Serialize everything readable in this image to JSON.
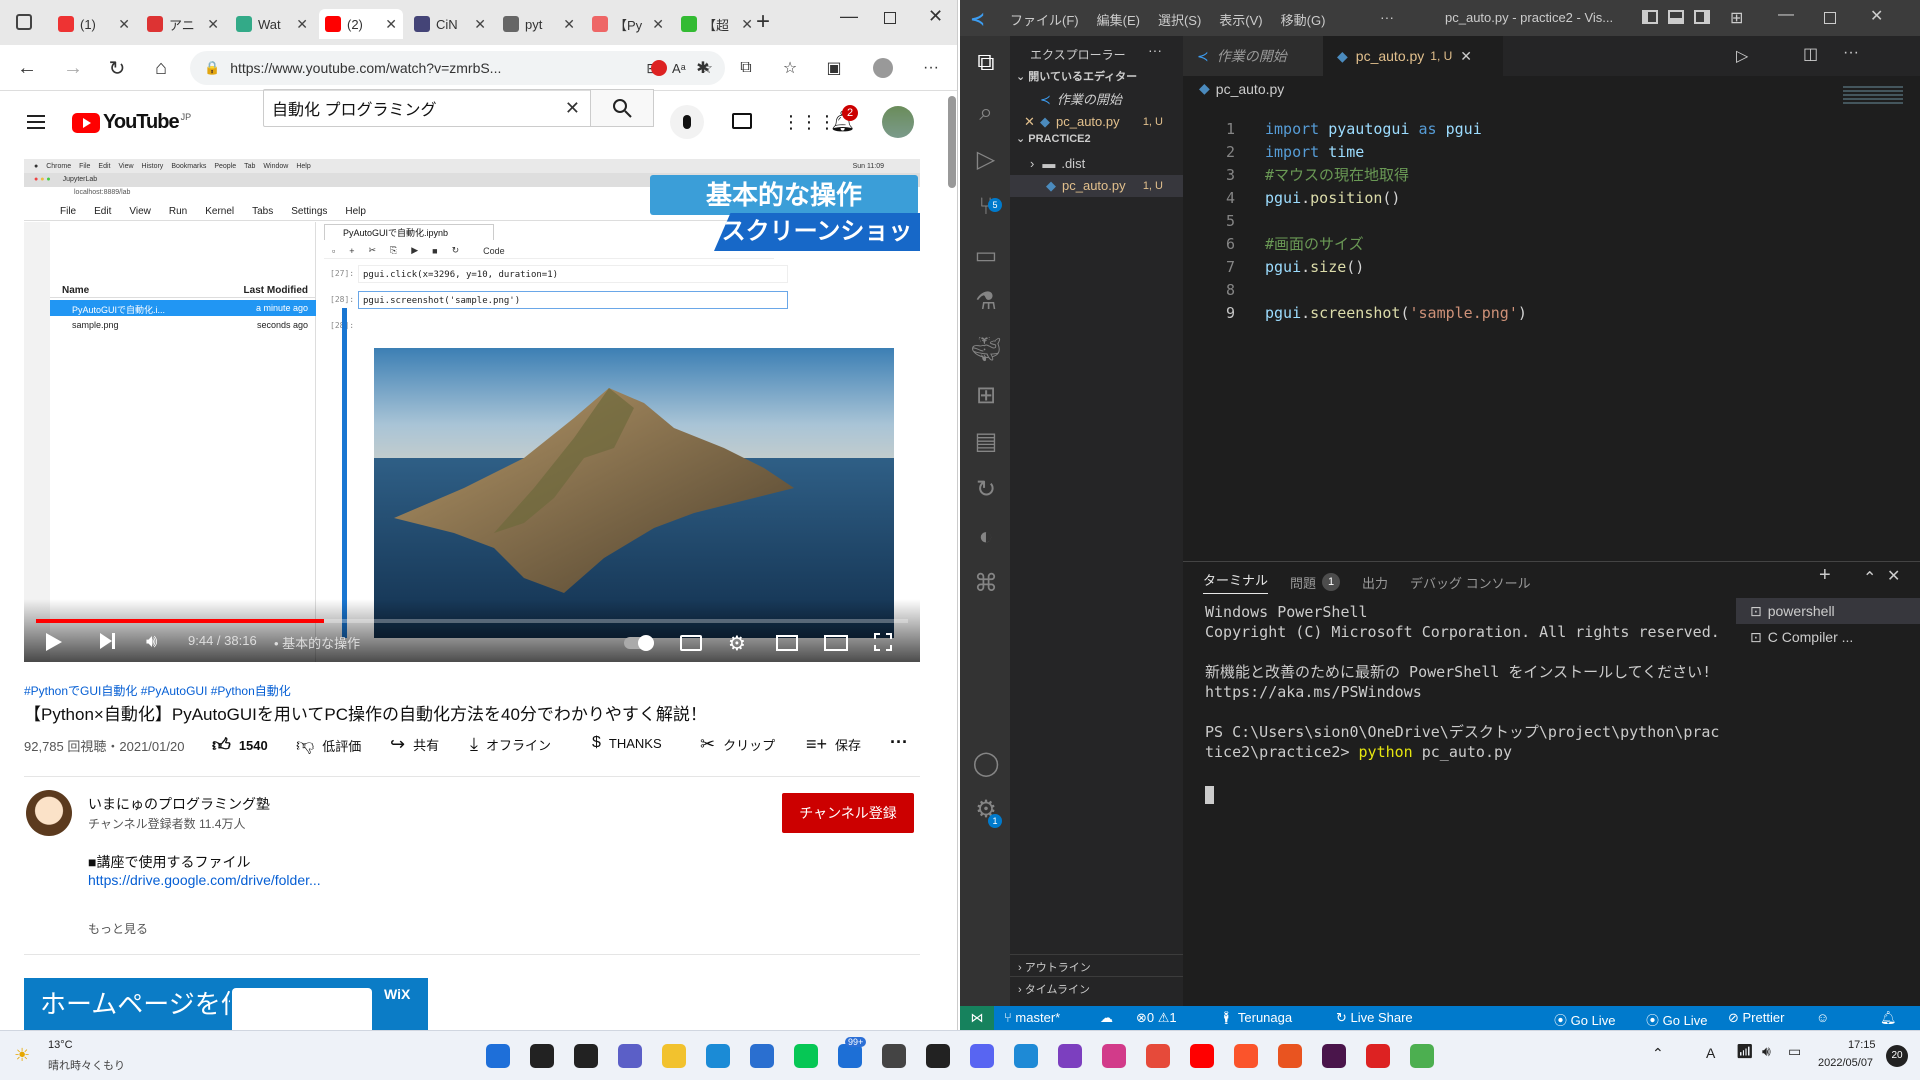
{
  "browser": {
    "tabs": [
      {
        "title": "(1)",
        "color": "#e33"
      },
      {
        "title": "アニ",
        "color": "#d33"
      },
      {
        "title": "Wat",
        "color": "#3a8"
      },
      {
        "title": "(2)",
        "color": "#f00"
      },
      {
        "title": "CiN",
        "color": "#447"
      },
      {
        "title": "pyt",
        "color": "#666"
      },
      {
        "title": "【Py",
        "color": "#e66"
      },
      {
        "title": "【超",
        "color": "#3b3"
      }
    ],
    "url": "https://www.youtube.com/watch?v=zmrbS..."
  },
  "youtube": {
    "logo_text": "YouTube",
    "logo_region": "JP",
    "search_value": "自動化 プログラミング",
    "notif_count": "2",
    "video": {
      "overlay_title1": "基本的な操作",
      "overlay_title2": "スクリーンショット",
      "notebook_tab": "PyAutoGUIで自動化.ipynb",
      "menu": [
        "File",
        "Edit",
        "View",
        "Run",
        "Kernel",
        "Tabs",
        "Settings",
        "Help"
      ],
      "mac_menu": [
        "Chrome",
        "File",
        "Edit",
        "View",
        "History",
        "Bookmarks",
        "People",
        "Tab",
        "Window",
        "Help"
      ],
      "mac_clock": "Sun 11:09",
      "browser_tab": "JupyterLab",
      "browser_url": "localhost:8889/lab",
      "file_col_name": "Name",
      "file_col_mod": "Last Modified",
      "files": [
        {
          "name": "PyAutoGUIで自動化.i...",
          "mod": "a minute ago"
        },
        {
          "name": "sample.png",
          "mod": "seconds ago"
        }
      ],
      "cells": [
        {
          "prompt": "[27]:",
          "code": "pgui.click(x=3296, y=10, duration=1)"
        },
        {
          "prompt": "[28]:",
          "code": "pgui.screenshot('sample.png')"
        },
        {
          "prompt": "[28]:",
          "code": ""
        }
      ],
      "toolbar_kind": "Code",
      "progress": 0.33,
      "time": "9:44 / 38:16",
      "chapter": "• 基本的な操作"
    },
    "hashtags": "#PythonでGUI自動化 #PyAutoGUI #Python自動化",
    "title": "【Python×自動化】PyAutoGUIを用いてPC操作の自動化方法を40分でわかりやすく解説！",
    "views": "92,785 回視聴・2021/01/20",
    "likes": "1540",
    "dislike": "低評価",
    "share": "共有",
    "offline": "オフライン",
    "thanks": "THANKS",
    "clip": "クリップ",
    "save": "保存",
    "channel_name": "いまにゅのプログラミング塾",
    "subscribers": "チャンネル登録者数 11.4万人",
    "subscribe_btn": "チャンネル登録",
    "desc_line1": "■講座で使用するファイル",
    "desc_link": "https://drive.google.com/drive/folder...",
    "show_more": "もっと見る",
    "ad_text": "ホームページを作成しよう",
    "ad_brand": "WiX"
  },
  "vscode": {
    "menus": [
      "ファイル(F)",
      "編集(E)",
      "選択(S)",
      "表示(V)",
      "移動(G)"
    ],
    "more": "···",
    "window_title": "pc_auto.py - practice2 - Vis...",
    "explorer_title": "エクスプローラー",
    "open_editors": "開いているエディター",
    "open_editor_items": [
      {
        "name": "作業の開始",
        "badge": ""
      },
      {
        "name": "pc_auto.py",
        "badge": "1, U"
      }
    ],
    "project": "PRACTICE2",
    "tree": [
      {
        "name": ".dist",
        "badge": ""
      },
      {
        "name": "pc_auto.py",
        "badge": "1, U"
      }
    ],
    "outline": "アウトライン",
    "timeline": "タイムライン",
    "tabs": [
      {
        "name": "作業の開始",
        "badge": ""
      },
      {
        "name": "pc_auto.py",
        "badge": "1, U"
      }
    ],
    "breadcrumb": "pc_auto.py",
    "code_lines": [
      {
        "n": "1",
        "t": [
          [
            "kw",
            "import "
          ],
          [
            "id",
            "pyautogui"
          ],
          [
            "kw",
            " as "
          ],
          [
            "id",
            "pgui"
          ]
        ]
      },
      {
        "n": "2",
        "t": [
          [
            "kw",
            "import "
          ],
          [
            "id",
            "time"
          ]
        ]
      },
      {
        "n": "3",
        "t": [
          [
            "cm",
            "#マウスの現在地取得"
          ]
        ]
      },
      {
        "n": "4",
        "t": [
          [
            "id",
            "pgui"
          ],
          [
            "tx",
            "."
          ],
          [
            "fn",
            "position"
          ],
          [
            "tx",
            "()"
          ]
        ]
      },
      {
        "n": "5",
        "t": []
      },
      {
        "n": "6",
        "t": [
          [
            "cm",
            "#画面のサイズ"
          ]
        ]
      },
      {
        "n": "7",
        "t": [
          [
            "id",
            "pgui"
          ],
          [
            "tx",
            "."
          ],
          [
            "fn",
            "size"
          ],
          [
            "tx",
            "()"
          ]
        ]
      },
      {
        "n": "8",
        "t": []
      },
      {
        "n": "9",
        "t": [
          [
            "id",
            "pgui"
          ],
          [
            "tx",
            "."
          ],
          [
            "fn",
            "screenshot"
          ],
          [
            "tx",
            "("
          ],
          [
            "st",
            "'sample.png'"
          ],
          [
            "tx",
            ")"
          ]
        ]
      }
    ],
    "panel_tabs": [
      {
        "name": "ターミナル"
      },
      {
        "name": "問題",
        "badge": "1"
      },
      {
        "name": "出力"
      },
      {
        "name": "デバッグ コンソール"
      }
    ],
    "terminal_lines": [
      "Windows PowerShell",
      "Copyright (C) Microsoft Corporation. All rights reserved.",
      "",
      "新機能と改善のために最新の PowerShell をインストールしてください!https://aka.ms/PSWindows",
      "",
      "PS C:\\Users\\sion0\\OneDrive\\デスクトップ\\project\\python\\practice2\\practice2> python pc_auto.py"
    ],
    "terminal_list": [
      "powershell",
      "C Compiler ..."
    ],
    "status": {
      "branch": "master*",
      "problems": "⊗0 ⚠1",
      "user": "Terunaga",
      "liveshare": "Live Share",
      "golive1": "Go Live",
      "golive2": "Go Live",
      "prettier": "Prettier"
    },
    "scm_badge": "5",
    "gear_badge": "1"
  },
  "taskbar": {
    "weather_temp": "13°C",
    "weather_desc": "晴れ時々くもり",
    "time": "17:15",
    "date": "2022/05/07",
    "notif": "20",
    "mail_badge": "99+",
    "ime": "A"
  }
}
